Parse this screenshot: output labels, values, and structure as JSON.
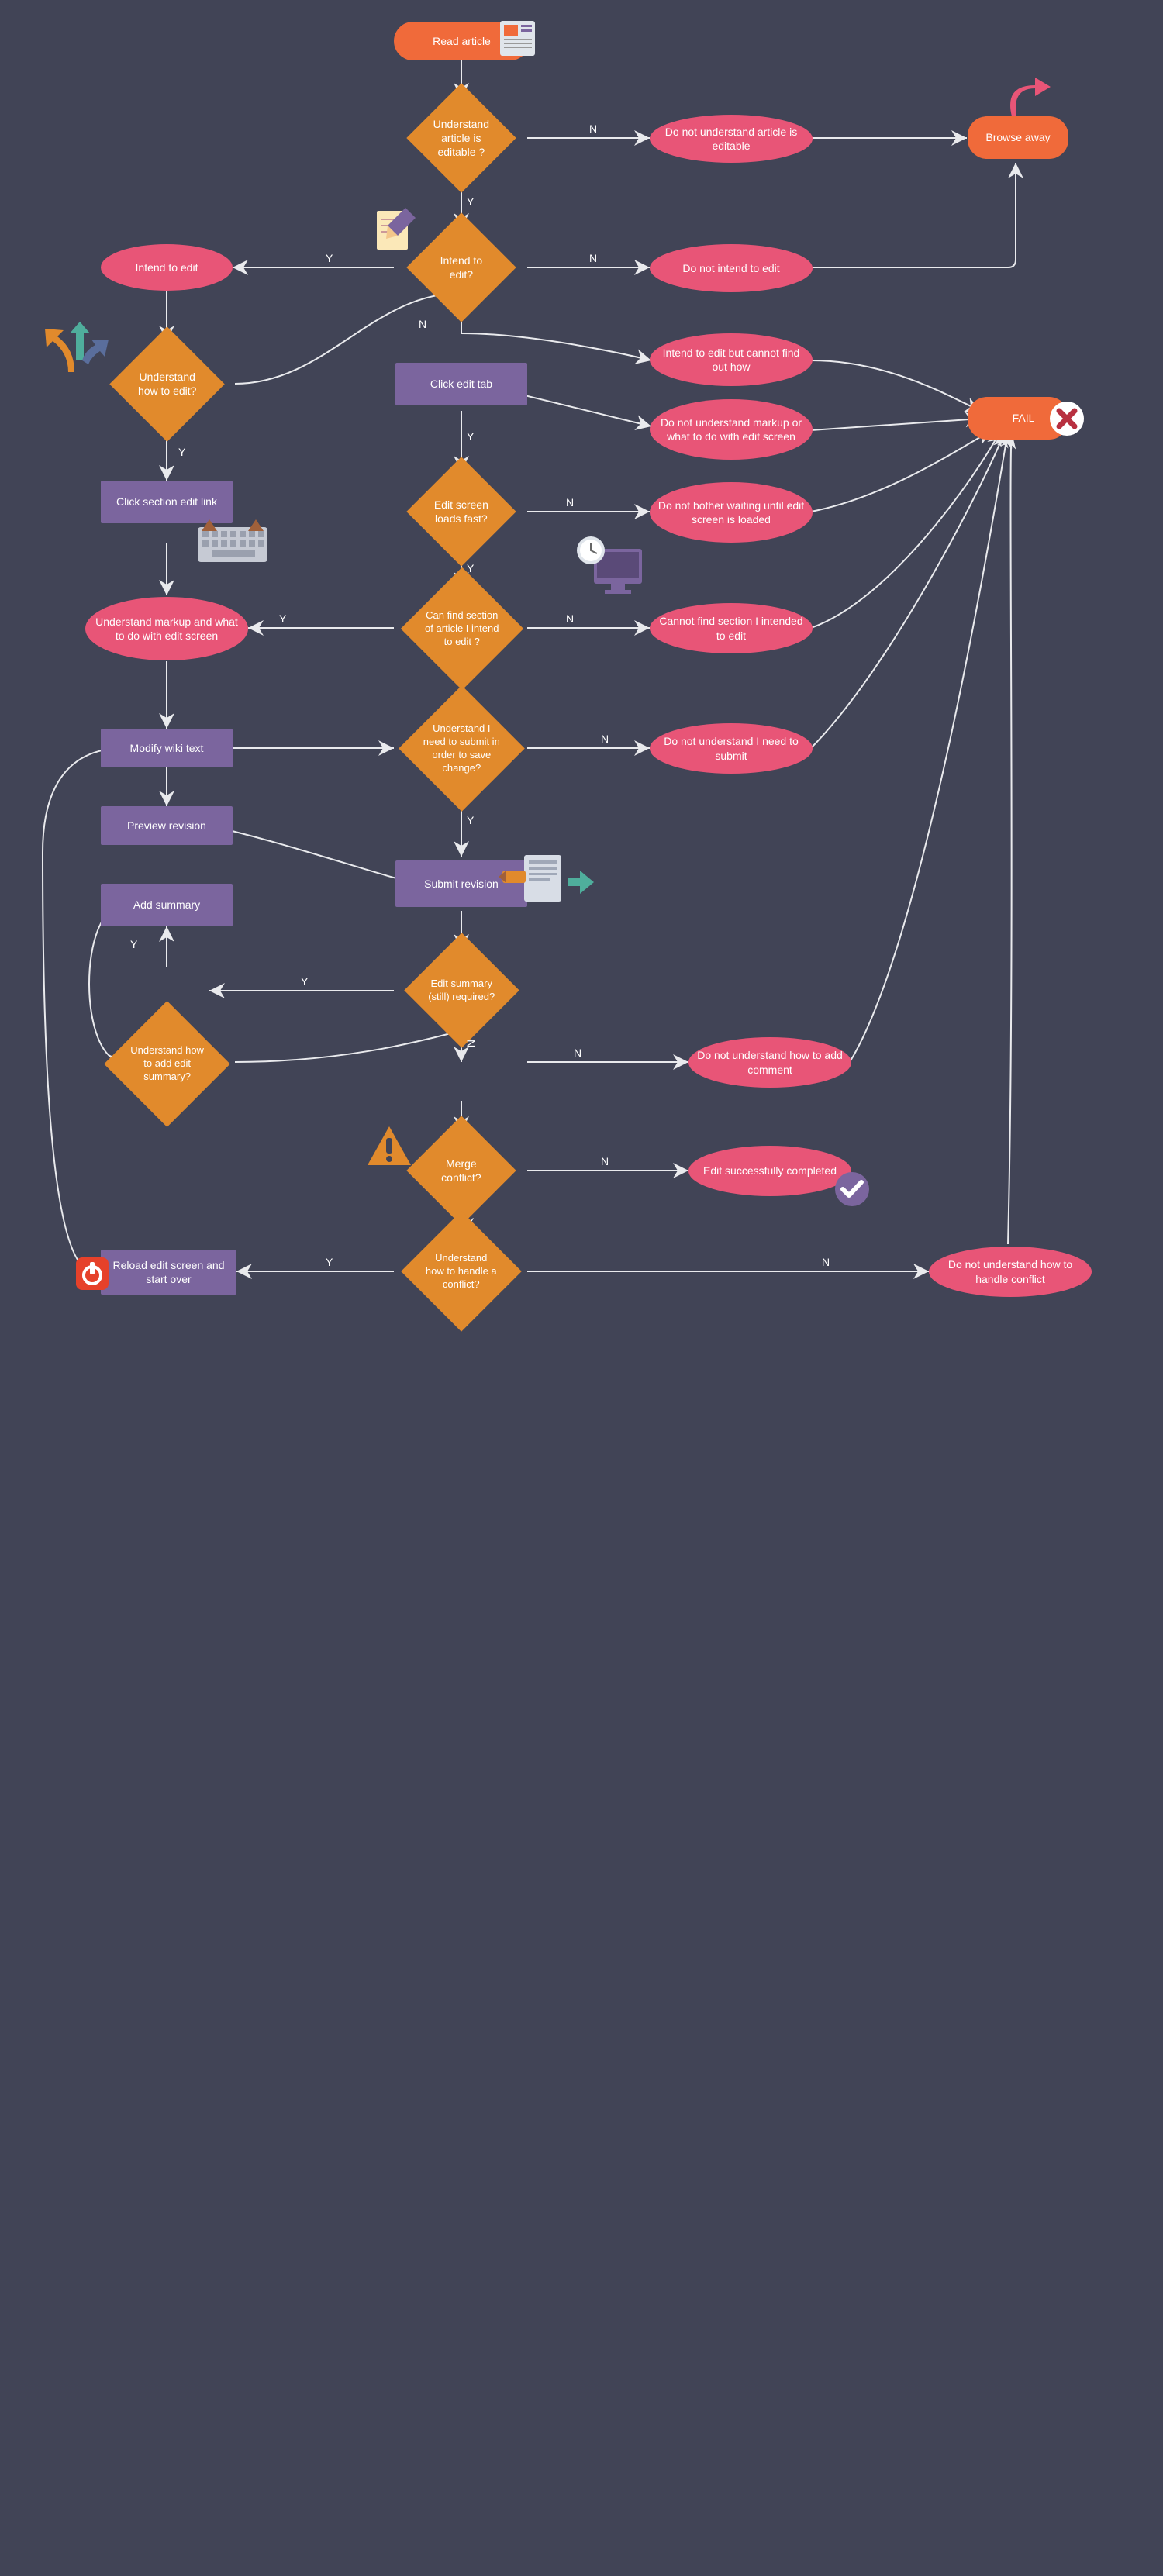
{
  "nodes": {
    "read_article": "Read article",
    "understand_editable": "Understand article is editable ?",
    "not_understand_editable": "Do not understand article is editable",
    "browse_away": "Browse away",
    "intend_edit_q": "Intend to edit?",
    "intend_edit": "Intend to edit",
    "not_intend_edit": "Do not intend to edit",
    "understand_how": "Understand how to edit?",
    "click_edit_tab": "Click edit tab",
    "intend_cannot": "Intend to edit but cannot find out how",
    "not_understand_markup": "Do not understand markup or what to do with edit screen",
    "fail": "FAIL",
    "click_section": "Click section edit link",
    "edit_loads_fast": "Edit screen loads fast?",
    "not_bother_wait": "Do not bother waiting until edit screen is loaded",
    "can_find_section": "Can find section of article I intend to edit ?",
    "cannot_find_section": "Cannot find section I intended to edit",
    "understand_markup": "Understand markup and what to do with edit screen",
    "modify_wiki": "Modify wiki text",
    "understand_submit": "Understand I need to submit  in order to save change?",
    "not_understand_submit": "Do not understand I need to submit",
    "preview_revision": "Preview revision",
    "submit_revision": "Submit revision",
    "add_summary": "Add summary",
    "summary_required": "Edit summary (still) required?",
    "understand_add_summary": "Understand how to add edit summary?",
    "not_understand_comment": "Do not understand how to add comment",
    "merge_conflict": "Merge conflict?",
    "edit_completed": "Edit successfully completed",
    "understand_conflict": "Understand how to handle a conflict?",
    "not_understand_conflict": "Do not understand how to handle conflict",
    "reload_start_over": "Reload edit screen and start over"
  },
  "labels": {
    "n1": "N",
    "y1": "Y",
    "n2": "N",
    "y2": "Y",
    "n3": "N",
    "y3": "Y",
    "y4": "Y",
    "n4": "N",
    "y5": "Y",
    "n5": "N",
    "y6": "Y",
    "n6": "N",
    "y7": "Y",
    "y8": "Y",
    "n8": "N",
    "n8b": "N",
    "n9": "N",
    "y9": "Y",
    "y10": "Y",
    "n10": "N"
  },
  "colors": {
    "bg": "#414456",
    "orange": "#E18A2C",
    "pink": "#E85577",
    "purple": "#7B659E",
    "orangeT": "#F06A3A",
    "arrow": "#E9EAED"
  }
}
